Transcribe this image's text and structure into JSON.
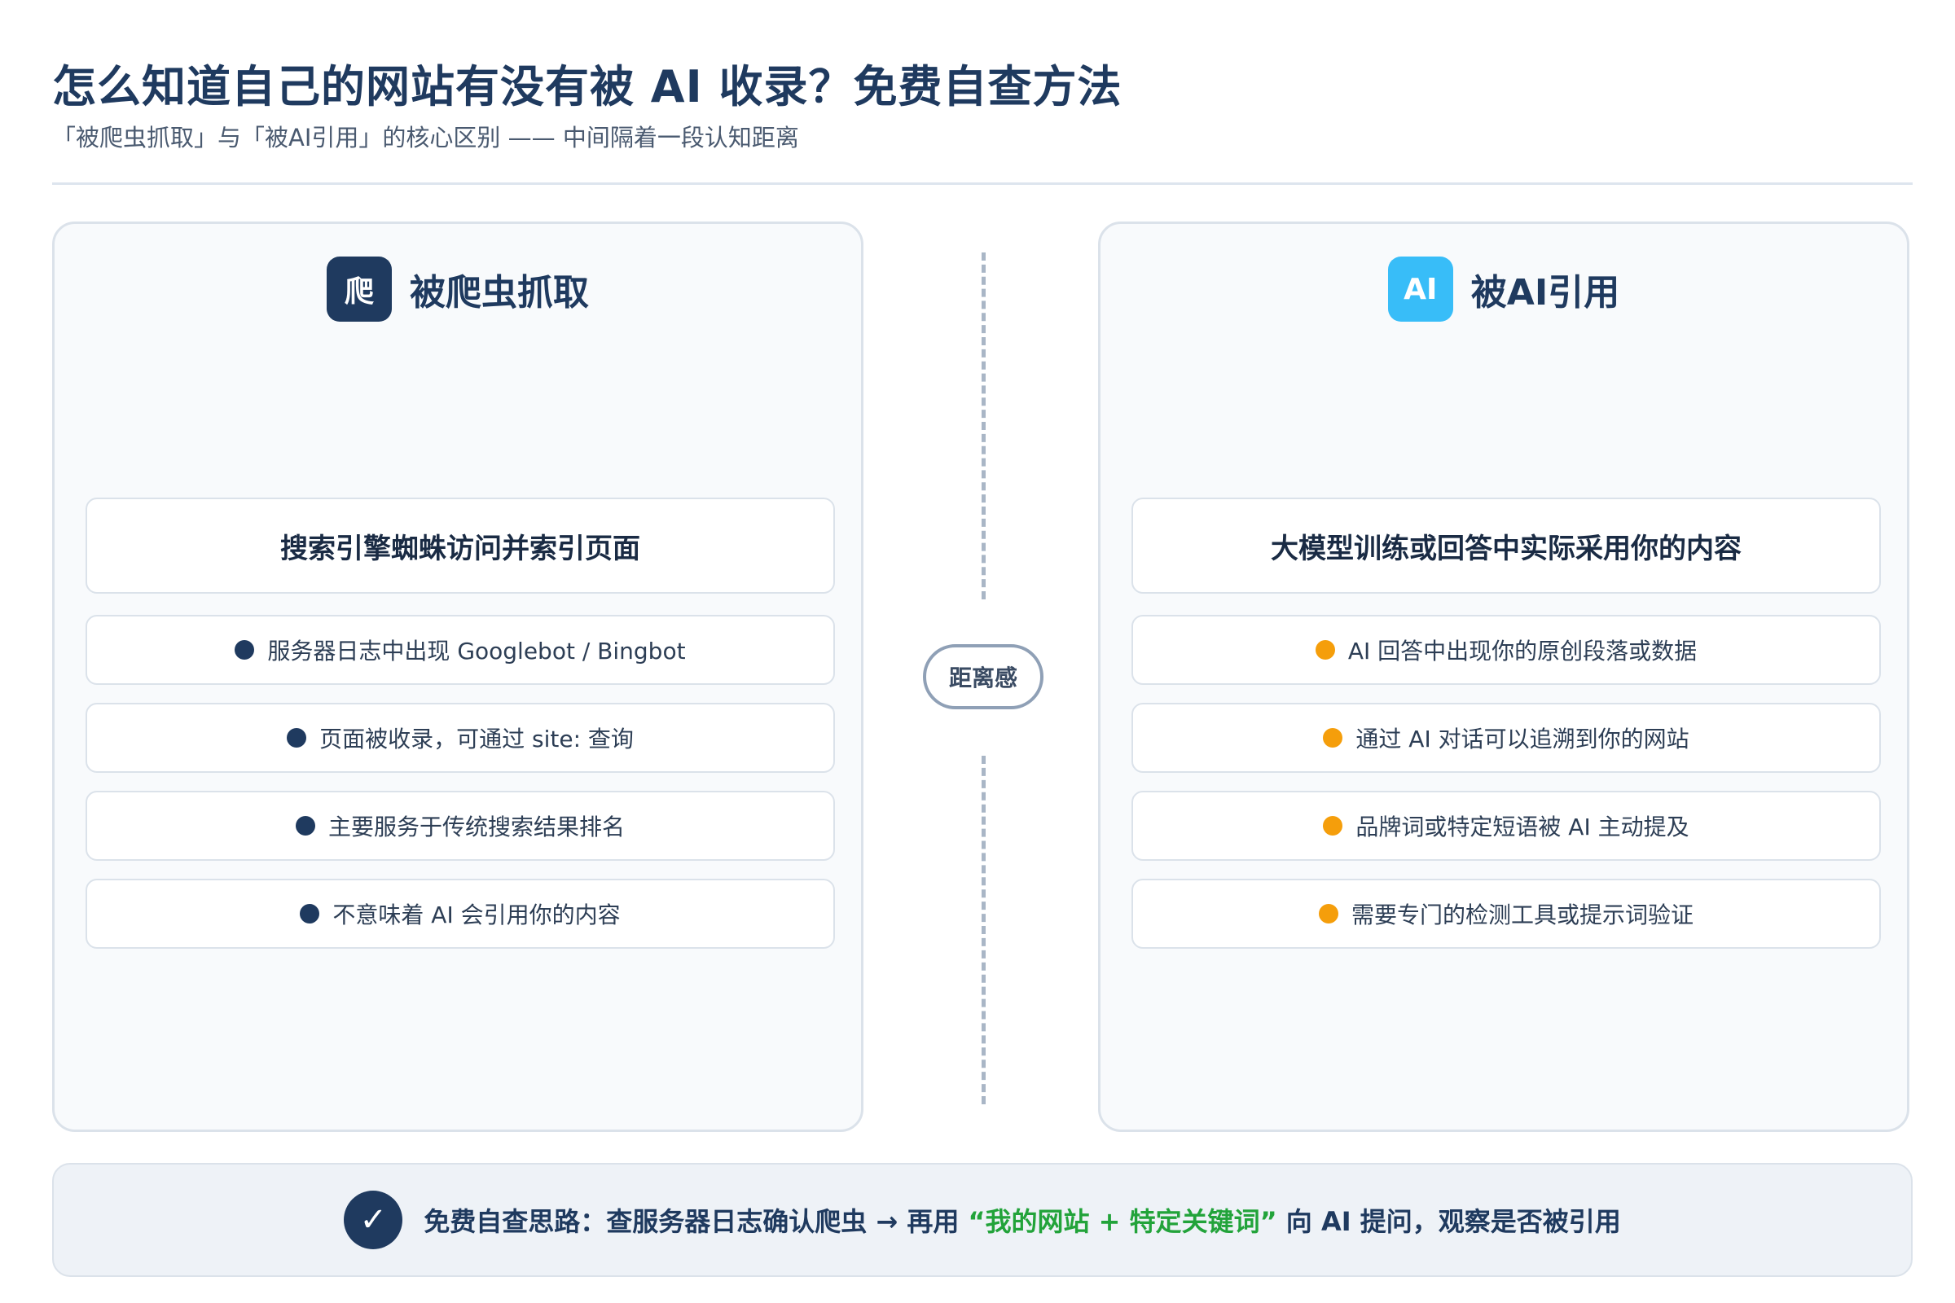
{
  "header": {
    "title": "怎么知道自己的网站有没有被 AI 收录？免费自查方法",
    "subtitle": "「被爬虫抓取」与「被AI引用」的核心区别 —— 中间隔着一段认知距离"
  },
  "left_panel": {
    "badge": "爬",
    "title": "被爬虫抓取",
    "main_card": "搜索引擎蜘蛛访问并索引页面",
    "items": [
      "服务器日志中出现 Googlebot / Bingbot",
      "页面被收录，可通过 site: 查询",
      "主要服务于传统搜索结果排名",
      "不意味着 AI 会引用你的内容"
    ],
    "accent": "#1f3a5f"
  },
  "right_panel": {
    "badge": "AI",
    "title": "被AI引用",
    "main_card": "大模型训练或回答中实际采用你的内容",
    "items": [
      "AI 回答中出现你的原创段落或数据",
      "通过 AI 对话可以追溯到你的网站",
      "品牌词或特定短语被 AI 主动提及",
      "需要专门的检测工具或提示词验证"
    ],
    "accent": "#38bdf8",
    "bullet_color": "#f59e0b"
  },
  "divider": {
    "label": "距离感"
  },
  "footer": {
    "check_icon": "✓",
    "text_before": "免费自查思路：查服务器日志确认爬虫 → 再用 ",
    "highlight": "“我的网站 + 特定关键词”",
    "text_after": " 向 AI 提问，观察是否被引用",
    "highlight_color": "#22a33a"
  }
}
